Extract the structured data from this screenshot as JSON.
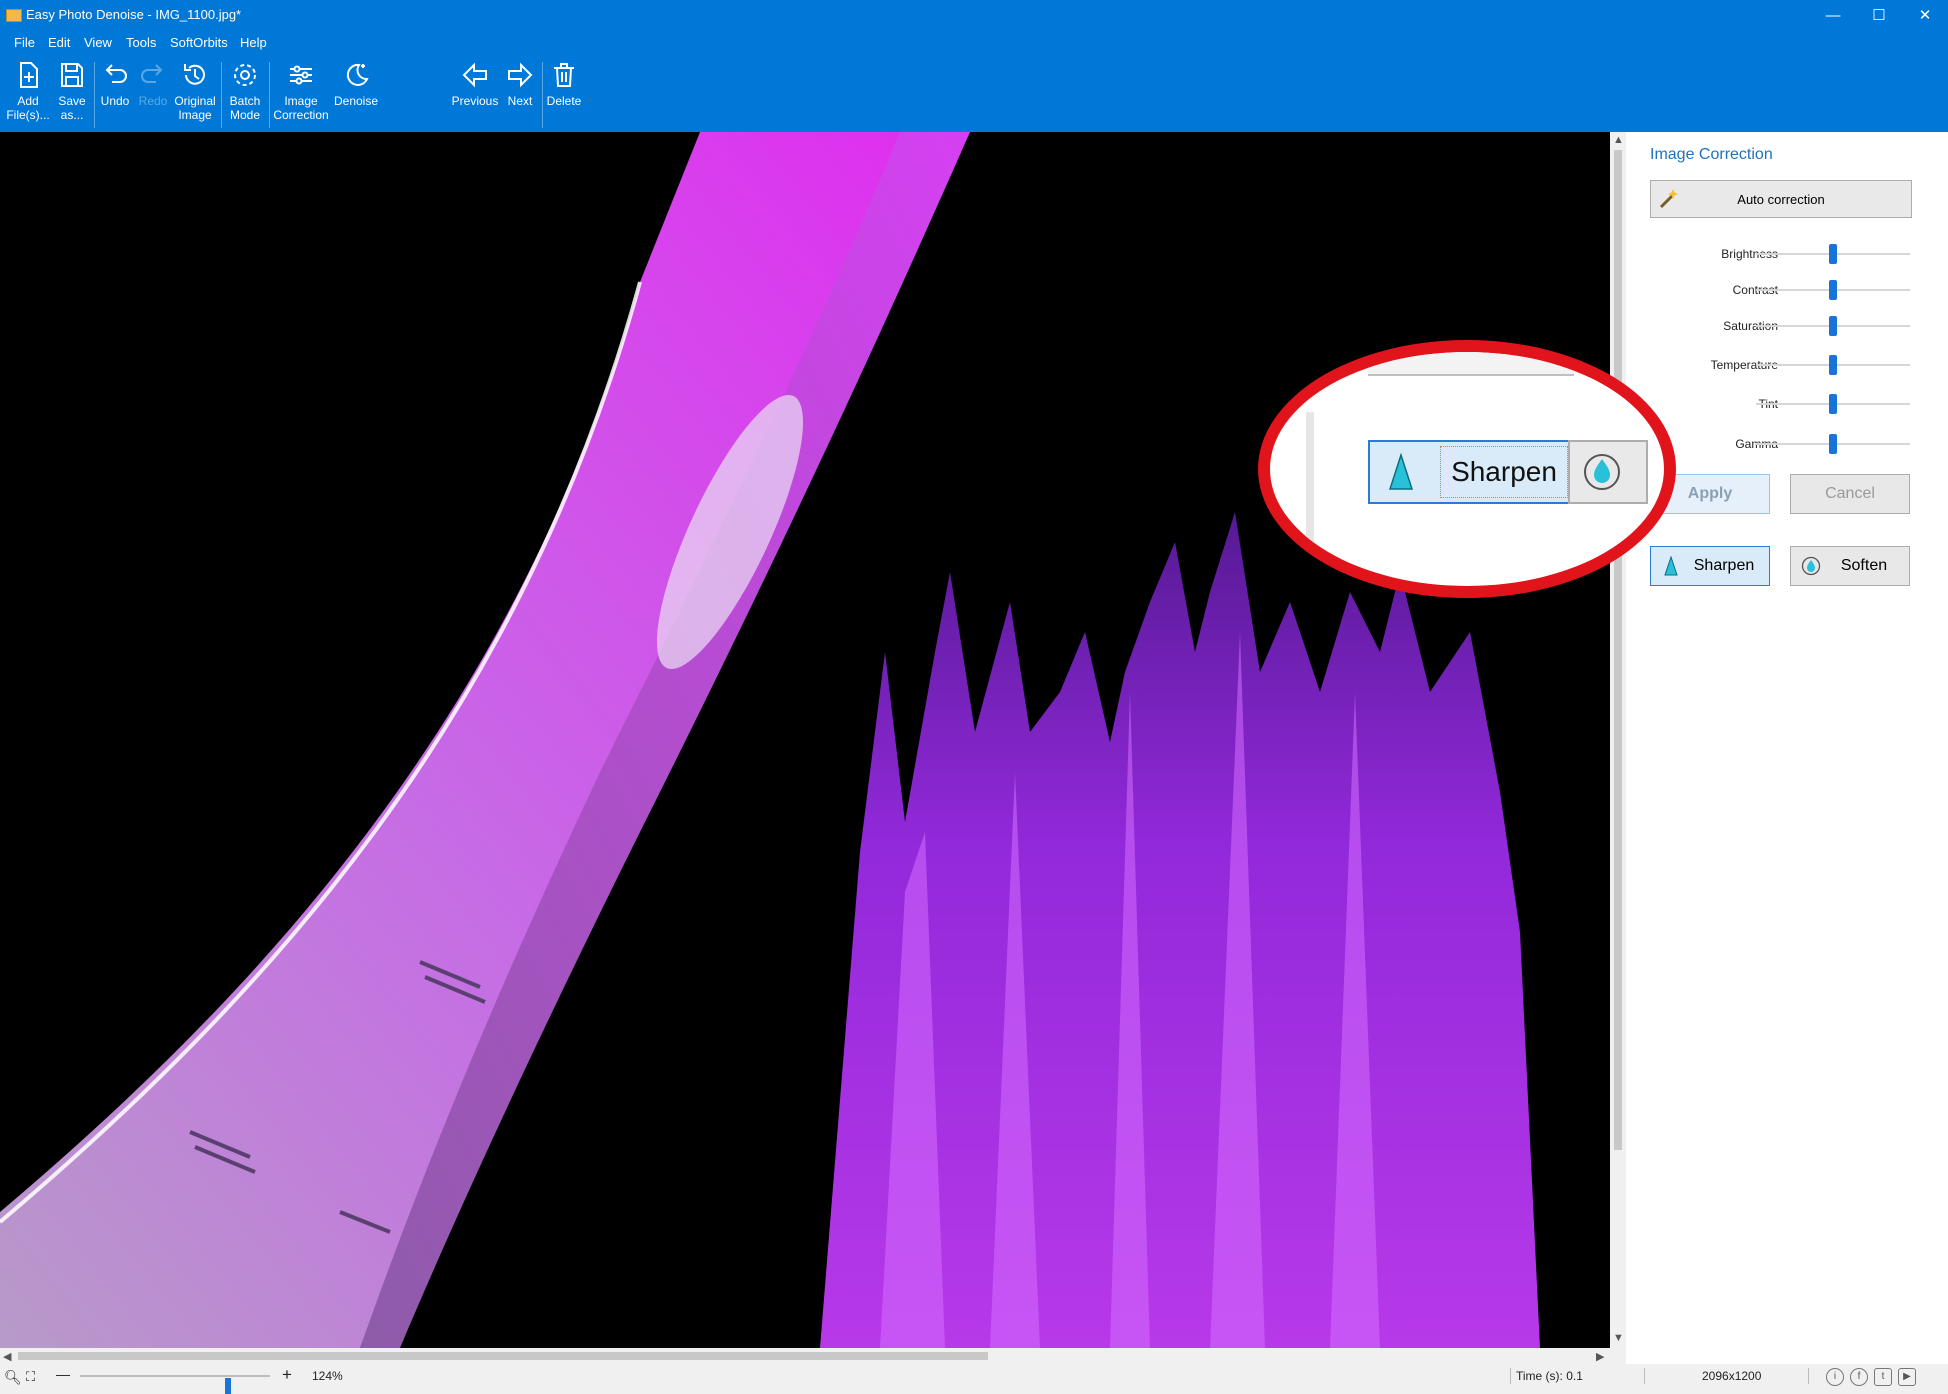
{
  "window": {
    "title": "Easy Photo Denoise - IMG_1100.jpg*",
    "minimize": "—",
    "maximize": "☐",
    "close": "✕"
  },
  "menu": [
    "File",
    "Edit",
    "View",
    "Tools",
    "SoftOrbits",
    "Help"
  ],
  "toolbar": {
    "add_files": "Add\nFile(s)...",
    "save_as": "Save\nas...",
    "undo": "Undo",
    "redo": "Redo",
    "original_image": "Original\nImage",
    "batch_mode": "Batch\nMode",
    "image_correction": "Image\nCorrection",
    "denoise": "Denoise",
    "previous": "Previous",
    "next": "Next",
    "delete": "Delete"
  },
  "panel": {
    "title": "Image Correction",
    "auto_correction": "Auto correction",
    "sliders": [
      {
        "label": "Brightness",
        "value": 0.5
      },
      {
        "label": "Contrast",
        "value": 0.5
      },
      {
        "label": "Saturation",
        "value": 0.5
      },
      {
        "label": "Temperature",
        "value": 0.5
      },
      {
        "label": "Tint",
        "value": 0.5
      },
      {
        "label": "Gamma",
        "value": 0.5
      }
    ],
    "apply": "Apply",
    "cancel": "Cancel",
    "sharpen": "Sharpen",
    "soften": "Soften"
  },
  "callout": {
    "sharpen": "Sharpen"
  },
  "status": {
    "zoom": "124%",
    "zoom_value": 0.78,
    "time": "Time (s): 0.1",
    "dimensions": "2096x1200"
  },
  "colors": {
    "accent": "#0078d7",
    "highlight_circle": "#e1141c",
    "photo_magenta": "#c23bff"
  }
}
